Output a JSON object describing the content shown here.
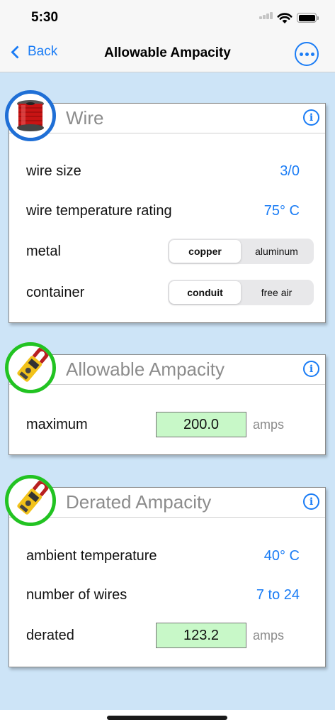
{
  "status": {
    "time": "5:30"
  },
  "nav": {
    "back_label": "Back",
    "title": "Allowable Ampacity"
  },
  "wire_card": {
    "title": "Wire",
    "info_label": "i",
    "rows": {
      "wire_size": {
        "label": "wire size",
        "value": "3/0"
      },
      "temp_rating": {
        "label": "wire temperature rating",
        "value": "75° C"
      },
      "metal": {
        "label": "metal",
        "options": [
          "copper",
          "aluminum"
        ],
        "selected": "copper"
      },
      "container": {
        "label": "container",
        "options": [
          "conduit",
          "free air"
        ],
        "selected": "conduit"
      }
    }
  },
  "allowable_card": {
    "title": "Allowable Ampacity",
    "info_label": "i",
    "maximum": {
      "label": "maximum",
      "value": "200.0",
      "unit": "amps"
    }
  },
  "derated_card": {
    "title": "Derated Ampacity",
    "info_label": "i",
    "ambient": {
      "label": "ambient temperature",
      "value": "40° C"
    },
    "wires": {
      "label": "number of wires",
      "value": "7 to 24"
    },
    "derated": {
      "label": "derated",
      "value": "123.2",
      "unit": "amps"
    }
  },
  "colors": {
    "accent": "#1a7cf5",
    "wire_ring": "#1f6fd6",
    "meter_ring": "#22c322",
    "result_fill": "#c8f8c8",
    "background": "#cde4f7"
  },
  "icons": {
    "wire": "wire-spool-icon",
    "meter": "clamp-meter-icon"
  }
}
